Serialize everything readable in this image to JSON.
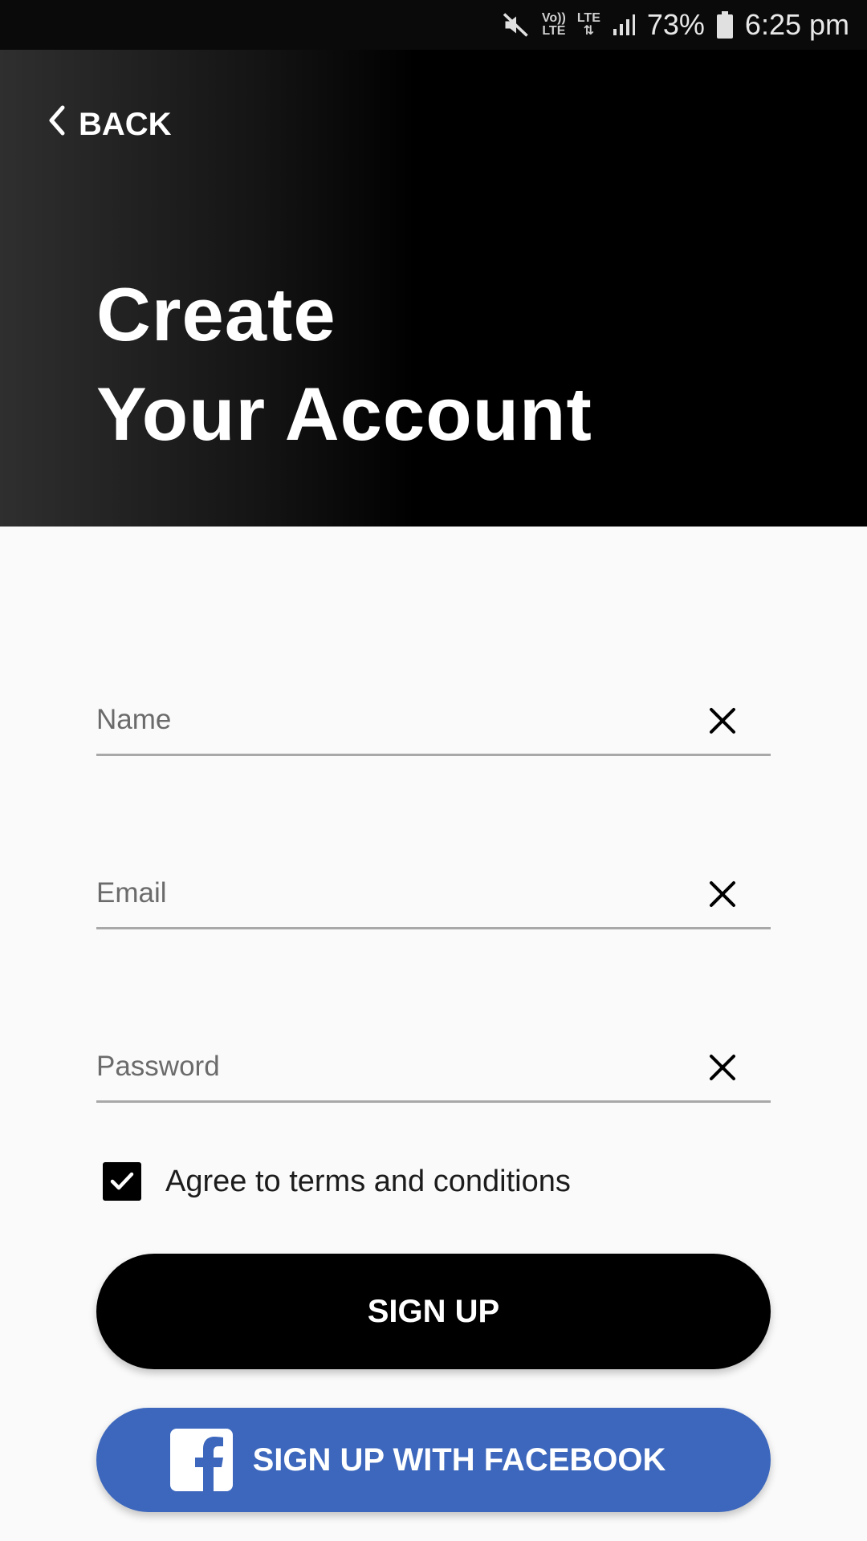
{
  "status_bar": {
    "volte_top": "Vo))",
    "volte_bottom": "LTE",
    "network": "LTE",
    "battery": "73%",
    "time": "6:25 pm"
  },
  "header": {
    "back_label": "BACK",
    "title_line1": "Create",
    "title_line2": "Your Account"
  },
  "form": {
    "name_placeholder": "Name",
    "email_placeholder": "Email",
    "password_placeholder": "Password",
    "agree_label": "Agree to terms and conditions",
    "agree_checked": true
  },
  "buttons": {
    "signup_label": "SIGN UP",
    "facebook_label": "SIGN UP WITH FACEBOOK"
  },
  "colors": {
    "primary": "#000000",
    "facebook": "#3c67bd",
    "background": "#fafafa"
  }
}
